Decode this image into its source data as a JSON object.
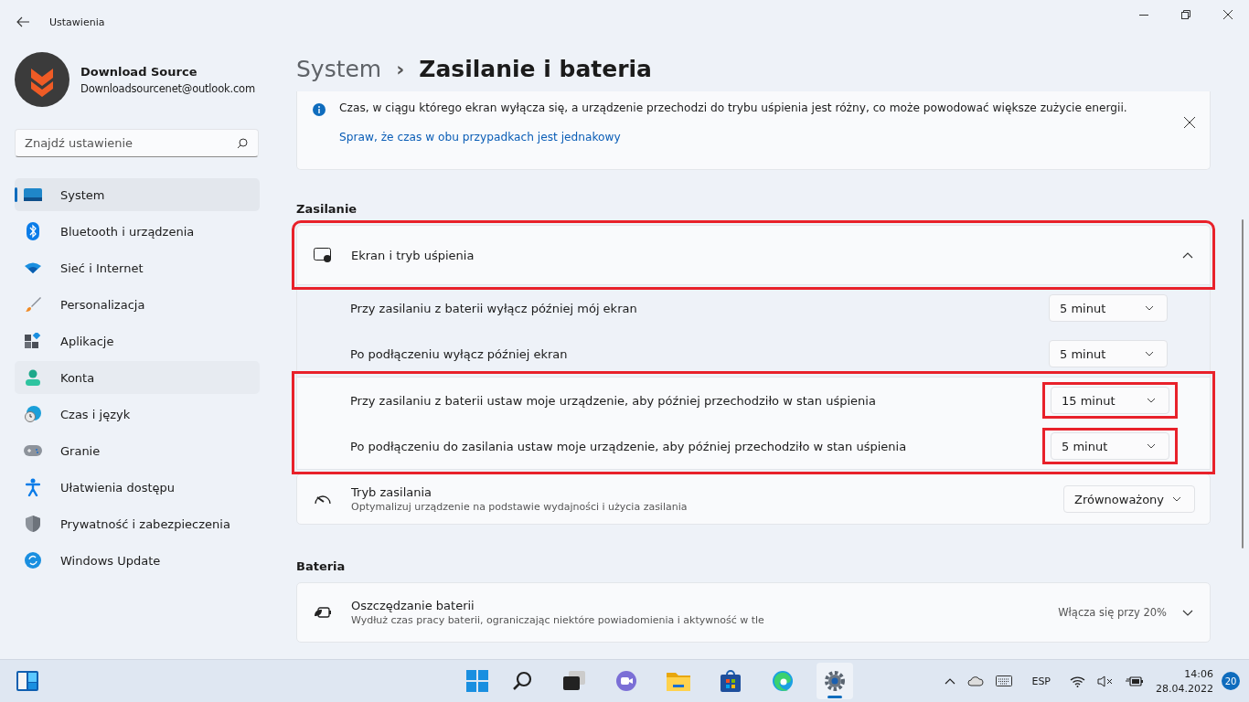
{
  "window": {
    "title": "Ustawienia"
  },
  "account": {
    "name": "Download Source",
    "email": "Downloadsourcenet@outlook.com"
  },
  "search": {
    "placeholder": "Znajdź ustawienie"
  },
  "sidebar": {
    "items": [
      {
        "label": "System",
        "kind": "system",
        "selected": true,
        "hovered": false
      },
      {
        "label": "Bluetooth i urządzenia",
        "kind": "bluetooth",
        "selected": false,
        "hovered": false
      },
      {
        "label": "Sieć i Internet",
        "kind": "wifi",
        "selected": false,
        "hovered": false
      },
      {
        "label": "Personalizacja",
        "kind": "brush",
        "selected": false,
        "hovered": false
      },
      {
        "label": "Aplikacje",
        "kind": "apps",
        "selected": false,
        "hovered": false
      },
      {
        "label": "Konta",
        "kind": "person",
        "selected": false,
        "hovered": true
      },
      {
        "label": "Czas i język",
        "kind": "clock",
        "selected": false,
        "hovered": false
      },
      {
        "label": "Granie",
        "kind": "gamepad",
        "selected": false,
        "hovered": false
      },
      {
        "label": "Ułatwienia dostępu",
        "kind": "access",
        "selected": false,
        "hovered": false
      },
      {
        "label": "Prywatność i zabezpieczenia",
        "kind": "shield",
        "selected": false,
        "hovered": false
      },
      {
        "label": "Windows Update",
        "kind": "update",
        "selected": false,
        "hovered": false
      }
    ]
  },
  "breadcrumb": {
    "parent": "System",
    "separator": "›",
    "current": "Zasilanie i bateria"
  },
  "info_bar": {
    "message": "Czas, w ciągu którego ekran wyłącza się, a urządzenie przechodzi do trybu uśpienia jest różny, co może powodować większe zużycie energii.",
    "link": "Spraw, że czas w obu przypadkach jest jednakowy"
  },
  "power_section": {
    "heading": "Zasilanie",
    "expander": {
      "title": "Ekran i tryb uśpienia",
      "expanded": true,
      "highlighted": true,
      "screen_rows": [
        {
          "label": "Przy zasilaniu z baterii wyłącz później mój ekran",
          "value": "5 minut",
          "highlighted": false
        },
        {
          "label": "Po podłączeniu wyłącz później ekran",
          "value": "5 minut",
          "highlighted": false
        }
      ],
      "sleep_group": {
        "highlighted": true,
        "rows": [
          {
            "label": "Przy zasilaniu z baterii ustaw moje urządzenie, aby później przechodziło w stan uśpienia",
            "value": "15 minut",
            "highlighted": true
          },
          {
            "label": "Po podłączeniu do zasilania ustaw moje urządzenie, aby później przechodziło w stan uśpienia",
            "value": "5 minut",
            "highlighted": true
          }
        ]
      }
    },
    "power_mode": {
      "title": "Tryb zasilania",
      "description": "Optymalizuj urządzenie na podstawie wydajności i użycia zasilania",
      "value": "Zrównoważony"
    }
  },
  "battery_section": {
    "heading": "Bateria",
    "saver": {
      "title": "Oszczędzanie baterii",
      "description": "Wydłuż czas pracy baterii, ograniczając niektóre powiadomienia i aktywność w tle",
      "status": "Włącza się przy 20%",
      "expanded": false
    }
  },
  "taskbar": {
    "apps": [
      {
        "kind": "search",
        "active": false
      },
      {
        "kind": "taskview",
        "active": false
      },
      {
        "kind": "chat",
        "active": false
      },
      {
        "kind": "folder",
        "active": false
      },
      {
        "kind": "store",
        "active": false
      },
      {
        "kind": "edge",
        "active": false
      },
      {
        "kind": "settings",
        "active": true
      }
    ],
    "language": "ESP",
    "time": "14:06",
    "date": "28.04.2022",
    "notifications": "20"
  }
}
